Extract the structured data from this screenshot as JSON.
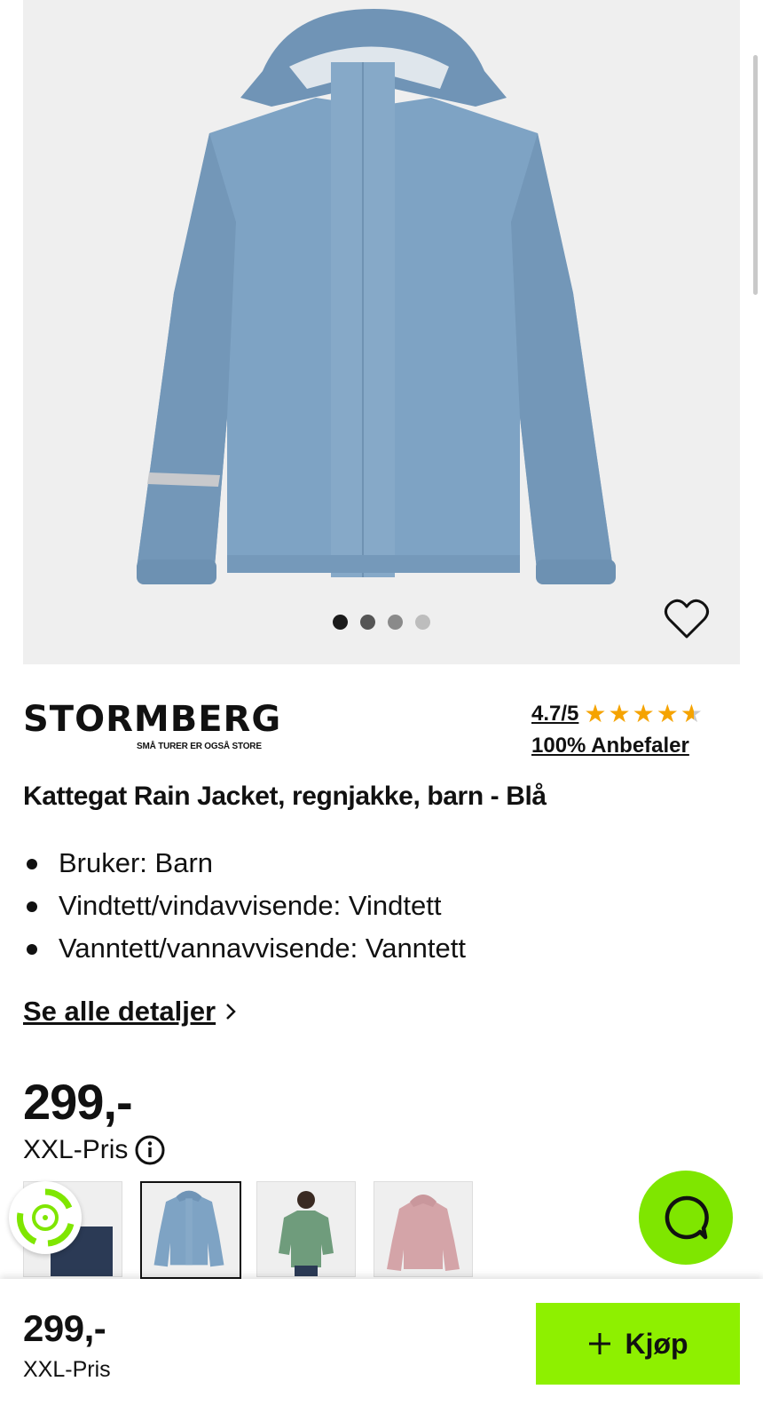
{
  "product": {
    "brand": {
      "name": "STORMBERG",
      "tagline": "SMÅ TURER ER OGSÅ STORE"
    },
    "rating": {
      "score": "4.7/5",
      "stars": 4.7,
      "recommend": "100% Anbefaler"
    },
    "title": "Kattegat Rain Jacket, regnjakke, barn - Blå",
    "specs": [
      "Bruker: Barn",
      "Vindtett/vindavvisende: Vindtett",
      "Vanntett/vannavvisende: Vanntett"
    ],
    "details_link": "Se alle detaljer",
    "price": "299,-",
    "price_label": "XXL-Pris"
  },
  "gallery": {
    "image_count": 4,
    "active_index": 0,
    "jacket_color": "#7ea3c4"
  },
  "variants": [
    {
      "name": "navy",
      "color": "#2b3a55"
    },
    {
      "name": "blue",
      "color": "#7ea3c4",
      "selected": true
    },
    {
      "name": "green",
      "color": "#6f9c7c"
    },
    {
      "name": "pink",
      "color": "#d4a4a8"
    }
  ],
  "bottom_bar": {
    "price": "299,-",
    "price_label": "XXL-Pris",
    "buy_label": "Kjøp"
  },
  "colors": {
    "accent": "#8ef000",
    "chat": "#7fe600",
    "star": "#f5a300"
  },
  "icons": [
    "heart-icon",
    "info-icon",
    "chevron-right-icon",
    "chat-icon",
    "plus-icon",
    "eco-icon",
    "star-icon"
  ]
}
